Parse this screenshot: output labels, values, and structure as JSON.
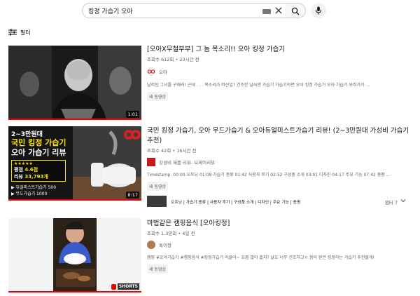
{
  "search": {
    "query": "킹정 가습기 오아"
  },
  "filter": {
    "label": "필터"
  },
  "results": [
    {
      "title": "[오아X무철부부] 그 놈 목소리!! 오아 킹정 가습기",
      "meta": "조회수 612회 • 23시간 전",
      "channel": "오아",
      "description": "날저진 그녀를 구해라! 근데 . . . 목소리가 머선일? 건조한 날씨엔 가습기 가습기하면 오아 킹정 가습기 오아 가습기 보러가기 ...",
      "badge": "새 동영상",
      "duration": "1:01"
    },
    {
      "title": "국민 킹정 가습기, 오아 무드가습기 & 오아듀얼미스트가습기 리뷰! (2~3만원대 가성비 가습기 추천)",
      "meta": "조회수 42회 • 16시간 전",
      "channel": "갓성비 제품 리뷰, 오제이리뷰",
      "description": "Timestamp. 00:00 오프닝 01:08 가습기 종류 01:42 사용자 후기 02:52 구성품 소개 03:01 디자인 04:17 주요 기능 07:42 총평 ...",
      "badge": "새 동영상",
      "duration": "8:17",
      "thumb_text": {
        "line1": "2~3만원대",
        "line2": "국민 킹정 가습기",
        "line3": "오아 가습기 리뷰",
        "stars": "★★★★★",
        "rating_label": "평점",
        "rating": "4.6점",
        "review_label": "리뷰",
        "reviews": "33,793개",
        "item1": "▶ 듀얼미스트가습기 500",
        "item2": "▶ 무드가습기 1000",
        "logo": "oa"
      },
      "chapters": {
        "text": "오프닝 | 가습기 종류 | 사용자 후기 | 구성품 소개 | 디자인 | 주요 기능 | 총평",
        "more": "챕터 7"
      }
    },
    {
      "title": "마법같은 캠핑음식 [오아킹정]",
      "meta": "조회수 1.3만회 • 4일 전",
      "channel": "톡이형",
      "description": "캠핑 #오아가습기 #캠핑음식 #킹정가습기 아들아~ 요즘 많이 춥지? 날도 너무 건조하고ㅠ 형이 완전 킹정하는 가습기 추천할게!",
      "badge": "새 동영상",
      "shorts": "SHORTS"
    }
  ]
}
